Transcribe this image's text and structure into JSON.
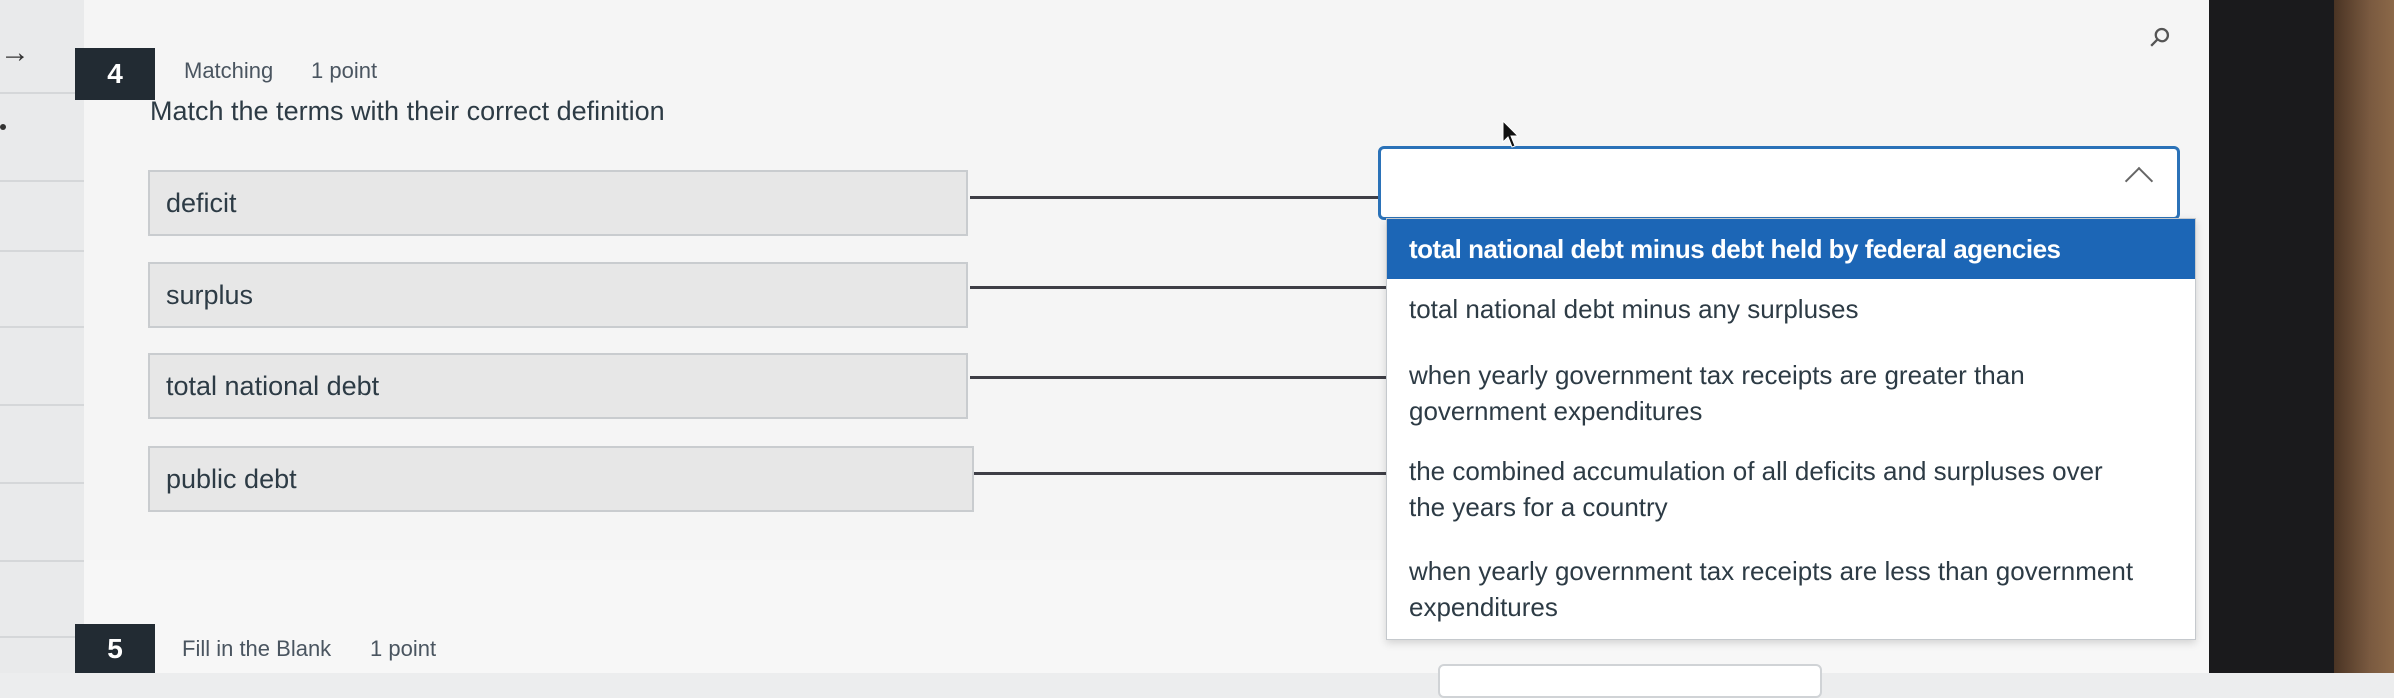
{
  "question4": {
    "number": "4",
    "type": "Matching",
    "points": "1 point",
    "prompt": "Match the terms with their correct definition",
    "terms": [
      "deficit",
      "surplus",
      "total national debt",
      "public debt"
    ]
  },
  "dropdown": {
    "selected_value": "",
    "options": [
      [
        "total national debt minus debt held by federal agencies"
      ],
      [
        "total national debt minus any surpluses"
      ],
      [
        "when yearly government tax receipts are greater than",
        "government expenditures"
      ],
      [
        "the combined accumulation of all deficits and surpluses over",
        "the years for a country"
      ],
      [
        "when yearly government tax receipts are less than government",
        "expenditures"
      ]
    ]
  },
  "question5": {
    "number": "5",
    "type": "Fill in the Blank",
    "points": "1 point"
  },
  "icons": {
    "pin": "pin-icon",
    "chevron": "chevron-up-icon",
    "cursor": "mouse-cursor-icon"
  },
  "colors": {
    "accent": "#1c66b6",
    "question_badge": "#222b33"
  }
}
